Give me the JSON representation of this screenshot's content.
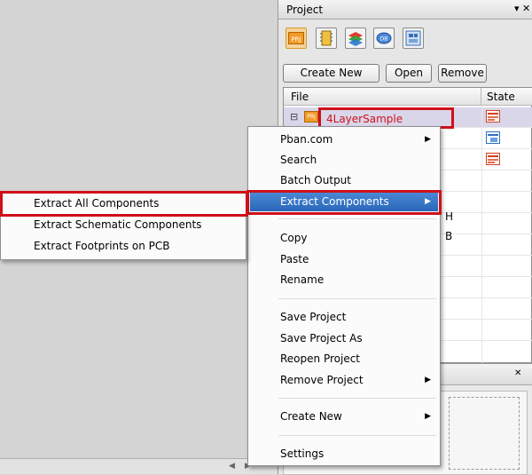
{
  "project_panel": {
    "title": "Project",
    "pin_glyph": "▾ ✕",
    "toolbar_icons": [
      {
        "name": "project-icon",
        "label": "PRJ"
      },
      {
        "name": "schematic-icon",
        "label": ""
      },
      {
        "name": "pcb-layers-icon",
        "label": ""
      },
      {
        "name": "database-icon",
        "label": "DB"
      },
      {
        "name": "library-icon",
        "label": ""
      }
    ],
    "buttons": {
      "create_new": "Create New",
      "open": "Open",
      "remove": "Remove"
    },
    "table": {
      "col_file": "File",
      "col_state": "State",
      "project_icon_label": "PRJ",
      "project_name": "4LayerSample",
      "expand_glyph": "⊟",
      "partial_text": [
        "H",
        "B"
      ]
    }
  },
  "context_menu": {
    "items": [
      {
        "label": "Pban.com",
        "submenu": true
      },
      {
        "label": "Search",
        "submenu": false
      },
      {
        "label": "Batch Output",
        "submenu": false
      },
      {
        "label": "Extract Components",
        "submenu": true,
        "highlighted": true
      },
      {
        "label": "Copy",
        "submenu": false
      },
      {
        "label": "Paste",
        "submenu": false
      },
      {
        "label": "Rename",
        "submenu": false
      },
      {
        "label": "Save Project",
        "submenu": false
      },
      {
        "label": "Save Project As",
        "submenu": false
      },
      {
        "label": "Reopen Project",
        "submenu": false
      },
      {
        "label": "Remove Project",
        "submenu": true
      },
      {
        "label": "Create New",
        "submenu": true
      },
      {
        "label": "Settings",
        "submenu": false
      }
    ],
    "arrow_glyph": "▶"
  },
  "submenu": {
    "items": [
      {
        "label": "Extract All Components"
      },
      {
        "label": "Extract Schematic Components"
      },
      {
        "label": "Extract Footprints on PCB"
      }
    ]
  },
  "colors": {
    "highlight_red": "#d0101a",
    "menu_highlight": "#2f6fc2",
    "project_name_red": "#d0101a"
  }
}
